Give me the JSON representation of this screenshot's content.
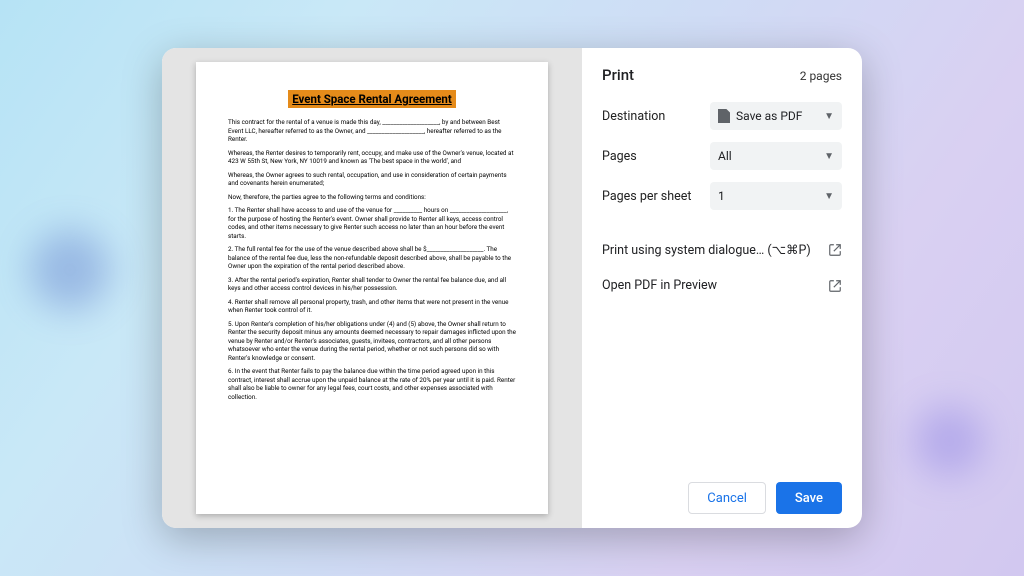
{
  "print": {
    "title": "Print",
    "page_count_label": "2 pages",
    "rows": {
      "destination": {
        "label": "Destination",
        "value": "Save as PDF"
      },
      "pages": {
        "label": "Pages",
        "value": "All"
      },
      "pps": {
        "label": "Pages per sheet",
        "value": "1"
      }
    },
    "links": {
      "system": "Print using system dialogue… (⌥⌘P)",
      "preview": "Open PDF in Preview"
    },
    "buttons": {
      "cancel": "Cancel",
      "save": "Save"
    }
  },
  "document": {
    "title": "Event Space Rental Agreement",
    "paragraphs": [
      "This contract for the rental of a venue is made this day, ____________________, by and between Best Event LLC, hereafter referred to as the Owner, and ____________________, hereafter referred to as the Renter.",
      "Whereas, the Renter desires to temporarily rent, occupy, and make use of the Owner's venue, located at 423 W 55th St, New York, NY 10019 and known as 'The best space in the world', and",
      "Whereas, the Owner agrees to such rental, occupation, and use in consideration of certain payments and covenants herein enumerated;",
      "Now, therefore, the parties agree to the following terms and conditions:",
      "1. The Renter shall have access to and use of the venue for __________ hours on ____________________, for the purpose of hosting the Renter's event. Owner shall provide to Renter all keys, access control codes, and other items necessary to give Renter such access no later than an hour before the event starts.",
      "2. The full rental fee for the use of the venue described above shall be $____________________. The balance of the rental fee due, less the non-refundable deposit described above, shall be payable to the Owner upon the expiration of the rental period described above.",
      "3. After the rental period's expiration, Renter shall tender to Owner the rental fee balance due, and all keys and other access control devices in his/her possession.",
      "4. Renter shall remove all personal property, trash, and other items that were not present in the venue when Renter took control of it.",
      "5. Upon Renter's completion of his/her obligations under (4) and (5) above, the Owner shall return to Renter the security deposit minus any amounts deemed necessary to repair damages inflicted upon the venue by Renter and/or Renter's associates, guests, invitees, contractors, and all other persons whatsoever who enter the venue during the rental period, whether or not such persons did so with Renter's knowledge or consent.",
      "6. In the event that Renter fails to pay the balance due within the time period agreed upon in this contract, interest shall accrue upon the unpaid balance at the rate of 20% per year until it is paid. Renter shall also be liable to owner for any legal fees, court costs, and other expenses associated with collection."
    ]
  }
}
